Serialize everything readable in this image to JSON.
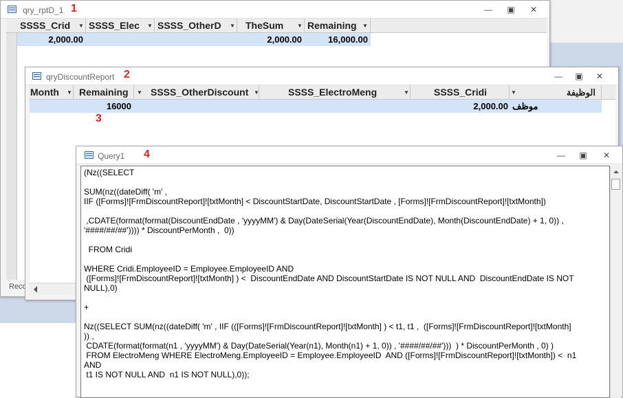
{
  "window1": {
    "title": "qry_rptD_1",
    "number": "1",
    "columns": [
      "SSSS_Crid",
      "SSSS_Elec",
      "SSSS_OtherD",
      "TheSum",
      "Remaining"
    ],
    "row": [
      "2,000.00",
      "",
      "",
      "2,000.00",
      "16,000.00"
    ],
    "record_label": "Reco"
  },
  "window2": {
    "title": "qryDiscountReport",
    "number": "2",
    "columns": [
      "Month",
      "Remaining",
      "SSSS_OtherDiscount",
      "SSSS_ElectroMeng",
      "SSSS_Cridi",
      "الوظيفة"
    ],
    "row": [
      "",
      "16000",
      "",
      "",
      "2,000.00",
      "موظف"
    ],
    "note_number": "3"
  },
  "window3": {
    "title": "Query1",
    "number": "4",
    "sql": "(Nz((SELECT\n\nSUM(nz((dateDiff( 'm' ,\nIIF ([Forms]![FrmDiscountReport]![txtMonth] < DiscountStartDate, DiscountStartDate , [Forms]![FrmDiscountReport]![txtMonth])\n\n ,CDATE(format(format(DiscountEndDate , 'yyyyMM') & Day(DateSerial(Year(DiscountEndDate), Month(DiscountEndDate) + 1, 0)) ,\n'####/##/##')))) * DiscountPerMonth ,  0))\n\n  FROM Cridi\n\nWHERE Cridi.EmployeeID = Employee.EmployeeID AND\n ([Forms]![FrmDiscountReport]![txtMonth] ) <  DiscountEndDate AND DiscountStartDate IS NOT NULL AND  DiscountEndDate IS NOT\nNULL),0)\n\n+\n\nNz((SELECT SUM(nz((dateDiff( 'm' , IIF (([Forms]![FrmDiscountReport]![txtMonth] ) < t1, t1 ,  ([Forms]![FrmDiscountReport]![txtMonth]\n)) ,\n CDATE(format(format(n1 , 'yyyyMM') & Day(DateSerial(Year(n1), Month(n1) + 1, 0)) , '####/##/##')))  ) * DiscountPerMonth , 0) )\n FROM ElectroMeng WHERE ElectroMeng.EmployeeID = Employee.EmployeeID  AND ([Forms]![FrmDiscountReport]![txtMonth]) <  n1\nAND\n t1 IS NOT NULL AND  n1 IS NOT NULL),0));"
  },
  "icons": [
    "datasheet-icon",
    "minimize-icon",
    "restore-icon",
    "close-icon",
    "dropdown-arrow-icon"
  ],
  "colors": {
    "selected_row": "#d3e4f8",
    "annotation_red": "#e2231a"
  }
}
